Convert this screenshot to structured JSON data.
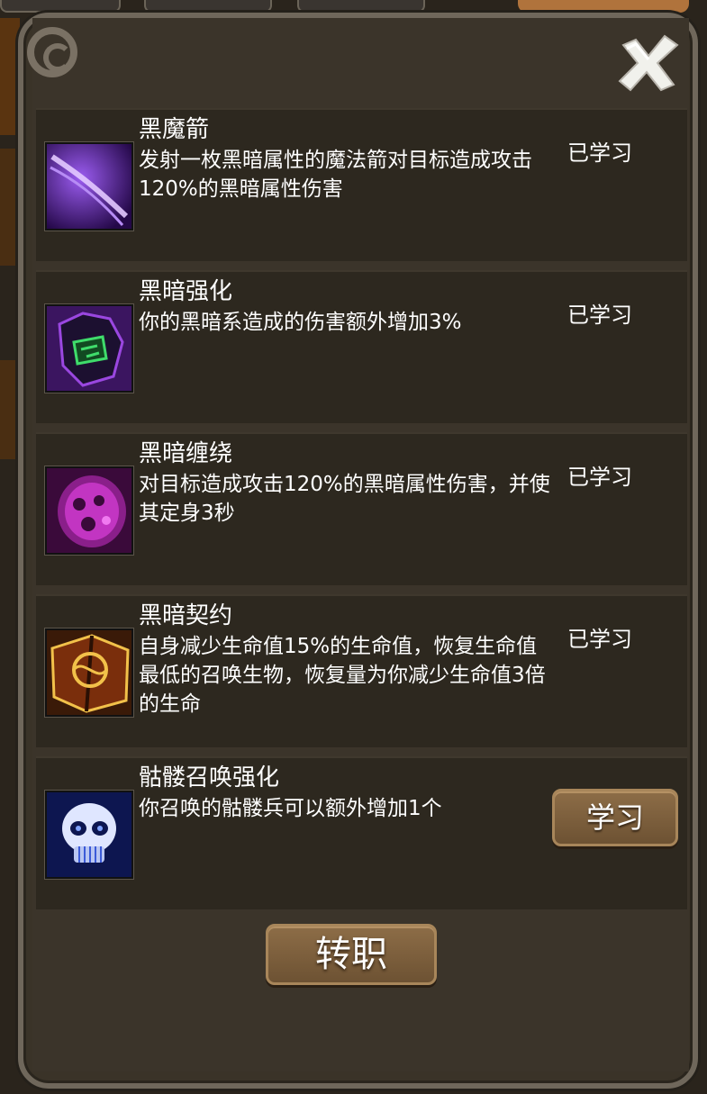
{
  "dialog": {
    "close_icon": "close-x-icon",
    "transfer_label": "转职"
  },
  "skills": [
    {
      "name": "黑魔箭",
      "desc": "发射一枚黑暗属性的魔法箭对目标造成攻击120%的黑暗属性伤害",
      "status": "已学习",
      "icon": "dark-arrow-icon",
      "icon_colors": [
        "#2a0a55",
        "#7a3bd6",
        "#e3c9ff"
      ]
    },
    {
      "name": "黑暗强化",
      "desc": "你的黑暗系造成的伤害额外增加3%",
      "status": "已学习",
      "icon": "dark-fist-rune-icon",
      "icon_colors": [
        "#3b1560",
        "#9a47e0",
        "#3fdc6b"
      ]
    },
    {
      "name": "黑暗缠绕",
      "desc": "对目标造成攻击120%的黑暗属性伤害，并使其定身3秒",
      "status": "已学习",
      "icon": "dark-entangle-icon",
      "icon_colors": [
        "#3a0a3a",
        "#c235c2",
        "#f07af0"
      ]
    },
    {
      "name": "黑暗契约",
      "desc": "自身减少生命值15%的生命值，恢复生命值最低的召唤生物，恢复量为你减少生命值3倍的生命",
      "status": "已学习",
      "icon": "dark-pact-book-icon",
      "icon_colors": [
        "#3a1a08",
        "#9a4a14",
        "#f2c14a"
      ]
    },
    {
      "name": "骷髅召唤强化",
      "desc": "你召唤的骷髅兵可以额外增加1个",
      "action_label": "学习",
      "icon": "skeleton-skull-icon",
      "icon_colors": [
        "#0d1650",
        "#3c5bd8",
        "#dfe6ff"
      ]
    }
  ]
}
